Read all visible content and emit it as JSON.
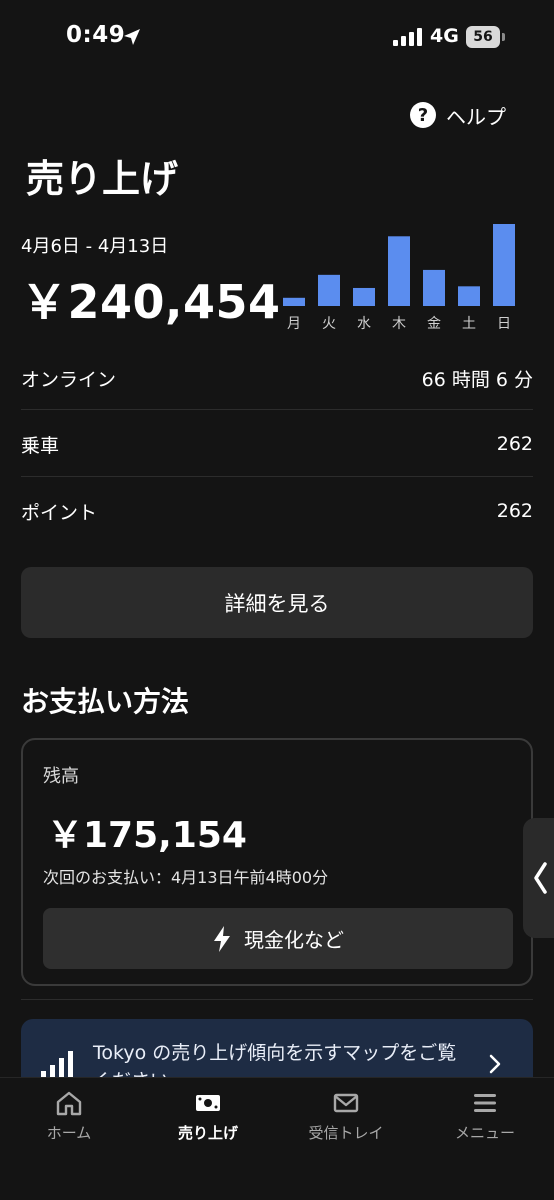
{
  "status_bar": {
    "time": "0:49",
    "network": "4G",
    "battery": "56"
  },
  "header": {
    "help_label": "ヘルプ",
    "title": "売り上げ"
  },
  "summary": {
    "date_range": "4月6日 - 4月13日",
    "total": "￥240,454"
  },
  "chart_data": {
    "type": "bar",
    "categories": [
      "月",
      "火",
      "水",
      "木",
      "金",
      "土",
      "日"
    ],
    "values": [
      0.1,
      0.38,
      0.22,
      0.85,
      0.44,
      0.24,
      1.0
    ],
    "ylim": [
      0,
      1
    ],
    "bar_color": "#5b8def",
    "grid": false
  },
  "stats": [
    {
      "label": "オンライン",
      "value": "66 時間 6 分"
    },
    {
      "label": "乗車",
      "value": "262"
    },
    {
      "label": "ポイント",
      "value": "262"
    }
  ],
  "details_button": "詳細を見る",
  "payment": {
    "section_title": "お支払い方法",
    "balance_label": "残高",
    "balance_amount": "￥175,154",
    "next_payment": "次回のお支払い：4月13日午前4時00分",
    "cashout_label": "現金化など"
  },
  "promo": {
    "text": "Tokyo の売り上げ傾向を示すマップをご覧ください"
  },
  "nav": [
    {
      "label": "ホーム",
      "icon": "home-icon"
    },
    {
      "label": "売り上げ",
      "icon": "earnings-icon",
      "active": true
    },
    {
      "label": "受信トレイ",
      "icon": "mail-icon"
    },
    {
      "label": "メニュー",
      "icon": "menu-icon"
    }
  ],
  "colors": {
    "background": "#141414",
    "accent": "#5b8def",
    "card": "#2b2b2b",
    "promo_bg": "#1e2c44"
  }
}
